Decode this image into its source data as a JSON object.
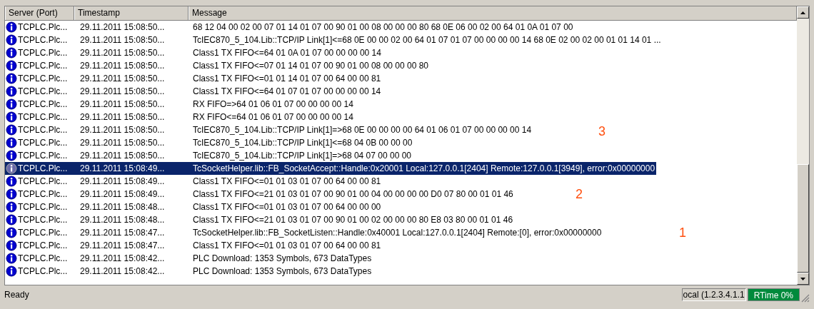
{
  "columns": [
    "Server (Port)",
    "Timestamp",
    "Message"
  ],
  "rows": [
    {
      "server": "TCPLC.Plc...",
      "timestamp": "29.11.2011 15:08:50...",
      "message": "68 12 04 00 02 00 07 01 14 01 07 00 90 01 00 08 00 00 00 80 68 0E 06 00 02 00 64 01 0A 01 07 00",
      "selected": false
    },
    {
      "server": "TCPLC.Plc...",
      "timestamp": "29.11.2011 15:08:50...",
      "message": "TcIEC870_5_104.Lib::TCP/IP Link[1]<=68 0E 00 00 02 00 64 01 07 01 07 00 00 00 00 14 68 0E 02 00 02 00 01 01 14 01 ...",
      "selected": false
    },
    {
      "server": "TCPLC.Plc...",
      "timestamp": "29.11.2011 15:08:50...",
      "message": "Class1 TX FIFO<=64 01 0A 01 07 00 00 00 00 14",
      "selected": false
    },
    {
      "server": "TCPLC.Plc...",
      "timestamp": "29.11.2011 15:08:50...",
      "message": "Class1 TX FIFO<=07 01 14 01 07 00 90 01 00 08 00 00 00 80",
      "selected": false
    },
    {
      "server": "TCPLC.Plc...",
      "timestamp": "29.11.2011 15:08:50...",
      "message": "Class1 TX FIFO<=01 01 14 01 07 00 64 00 00 81",
      "selected": false
    },
    {
      "server": "TCPLC.Plc...",
      "timestamp": "29.11.2011 15:08:50...",
      "message": "Class1 TX FIFO<=64 01 07 01 07 00 00 00 00 14",
      "selected": false
    },
    {
      "server": "TCPLC.Plc...",
      "timestamp": "29.11.2011 15:08:50...",
      "message": "RX FIFO=>64 01 06 01 07 00 00 00 00 14",
      "selected": false
    },
    {
      "server": "TCPLC.Plc...",
      "timestamp": "29.11.2011 15:08:50...",
      "message": "RX FIFO<=64 01 06 01 07 00 00 00 00 14",
      "selected": false
    },
    {
      "server": "TCPLC.Plc...",
      "timestamp": "29.11.2011 15:08:50...",
      "message": "TcIEC870_5_104.Lib::TCP/IP Link[1]=>68 0E 00 00 00 00 64 01 06 01 07 00 00 00 00 14",
      "selected": false
    },
    {
      "server": "TCPLC.Plc...",
      "timestamp": "29.11.2011 15:08:50...",
      "message": "TcIEC870_5_104.Lib::TCP/IP Link[1]<=68 04 0B 00 00 00",
      "selected": false
    },
    {
      "server": "TCPLC.Plc...",
      "timestamp": "29.11.2011 15:08:50...",
      "message": "TcIEC870_5_104.Lib::TCP/IP Link[1]=>68 04 07 00 00 00",
      "selected": false
    },
    {
      "server": "TCPLC.Plc...",
      "timestamp": "29.11.2011 15:08:49...",
      "message": "TcSocketHelper.lib::FB_SocketAccept::Handle:0x20001 Local:127.0.0.1[2404] Remote:127.0.0.1[3949], error:0x00000000",
      "selected": true
    },
    {
      "server": "TCPLC.Plc...",
      "timestamp": "29.11.2011 15:08:49...",
      "message": "Class1 TX FIFO<=01 01 03 01 07 00 64 00 00 81",
      "selected": false
    },
    {
      "server": "TCPLC.Plc...",
      "timestamp": "29.11.2011 15:08:49...",
      "message": "Class1 TX FIFO<=21 01 03 01 07 00 90 01 00 04 00 00 00 00 D0 07 80 00 01 01 46",
      "selected": false
    },
    {
      "server": "TCPLC.Plc...",
      "timestamp": "29.11.2011 15:08:48...",
      "message": "Class1 TX FIFO<=01 01 03 01 07 00 64 00 00 00",
      "selected": false
    },
    {
      "server": "TCPLC.Plc...",
      "timestamp": "29.11.2011 15:08:48...",
      "message": "Class1 TX FIFO<=21 01 03 01 07 00 90 01 00 02 00 00 00 80 E8 03 80 00 01 01 46",
      "selected": false
    },
    {
      "server": "TCPLC.Plc...",
      "timestamp": "29.11.2011 15:08:47...",
      "message": "TcSocketHelper.lib::FB_SocketListen::Handle:0x40001 Local:127.0.0.1[2404] Remote:[0], error:0x00000000",
      "selected": false
    },
    {
      "server": "TCPLC.Plc...",
      "timestamp": "29.11.2011 15:08:47...",
      "message": "Class1 TX FIFO<=01 01 03 01 07 00 64 00 00 81",
      "selected": false
    },
    {
      "server": "TCPLC.Plc...",
      "timestamp": "29.11.2011 15:08:42...",
      "message": "PLC Download: 1353 Symbols, 673 DataTypes",
      "selected": false
    },
    {
      "server": "TCPLC.Plc...",
      "timestamp": "29.11.2011 15:08:42...",
      "message": "PLC Download: 1353 Symbols, 673 DataTypes",
      "selected": false
    }
  ],
  "annotations": [
    "3",
    "2",
    "1"
  ],
  "status_bar": {
    "text": "Ready",
    "target": "ocal (1.2.3.4.1.1",
    "rtime": "RTime 0%"
  }
}
